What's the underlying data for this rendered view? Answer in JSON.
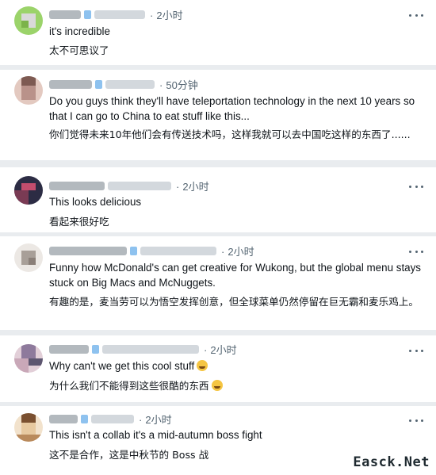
{
  "comments": [
    {
      "time": "2小时",
      "en": "it's incredible",
      "cn": "太不可思议了",
      "avatar_colors": [
        "#9bd36a",
        "#c9e7a5",
        "#d9d9d9",
        "#7bb34a"
      ]
    },
    {
      "time": "50分钟",
      "en": "Do you guys think they'll have teleportation technology in the next 10 years so that I can go to China to eat stuff like this...",
      "cn": "你们觉得未来10年他们会有传送技术吗，这样我就可以去中国吃这样的东西了......",
      "avatar_colors": [
        "#b9928a",
        "#e3c9c0",
        "#7d5a52",
        "#f0e0da"
      ]
    },
    {
      "time": "2小时",
      "en": "This looks delicious",
      "cn": "看起来很好吃",
      "avatar_colors": [
        "#1e1b2e",
        "#7a3b54",
        "#c44d6e",
        "#2c2c44"
      ]
    },
    {
      "time": "2小时",
      "en": "Funny how McDonald's can get creative for Wukong, but the global menu stays stuck on Big Macs and McNuggets.",
      "cn": "有趣的是，麦当劳可以为悟空发挥创意，但全球菜单仍然停留在巨无霸和麦乐鸡上。",
      "avatar_colors": [
        "#d8d2cc",
        "#a89f98",
        "#ece8e4",
        "#8a7f78"
      ]
    },
    {
      "time": "2小时",
      "en": "Why can't we get this cool stuff",
      "cn": "为什么我们不能得到这些很酷的东西",
      "avatar_colors": [
        "#c9a8b8",
        "#8e7a9c",
        "#e2cfd8",
        "#5d5670"
      ]
    },
    {
      "time": "2小时",
      "en": "This isn't a collab it's a mid-autumn boss fight",
      "cn": "这不是合作，这是中秋节的 Boss 战",
      "avatar_colors": [
        "#e7c9a0",
        "#b98a5c",
        "#f2e2cc",
        "#7a5030"
      ]
    }
  ],
  "watermark": "Easck.Net"
}
